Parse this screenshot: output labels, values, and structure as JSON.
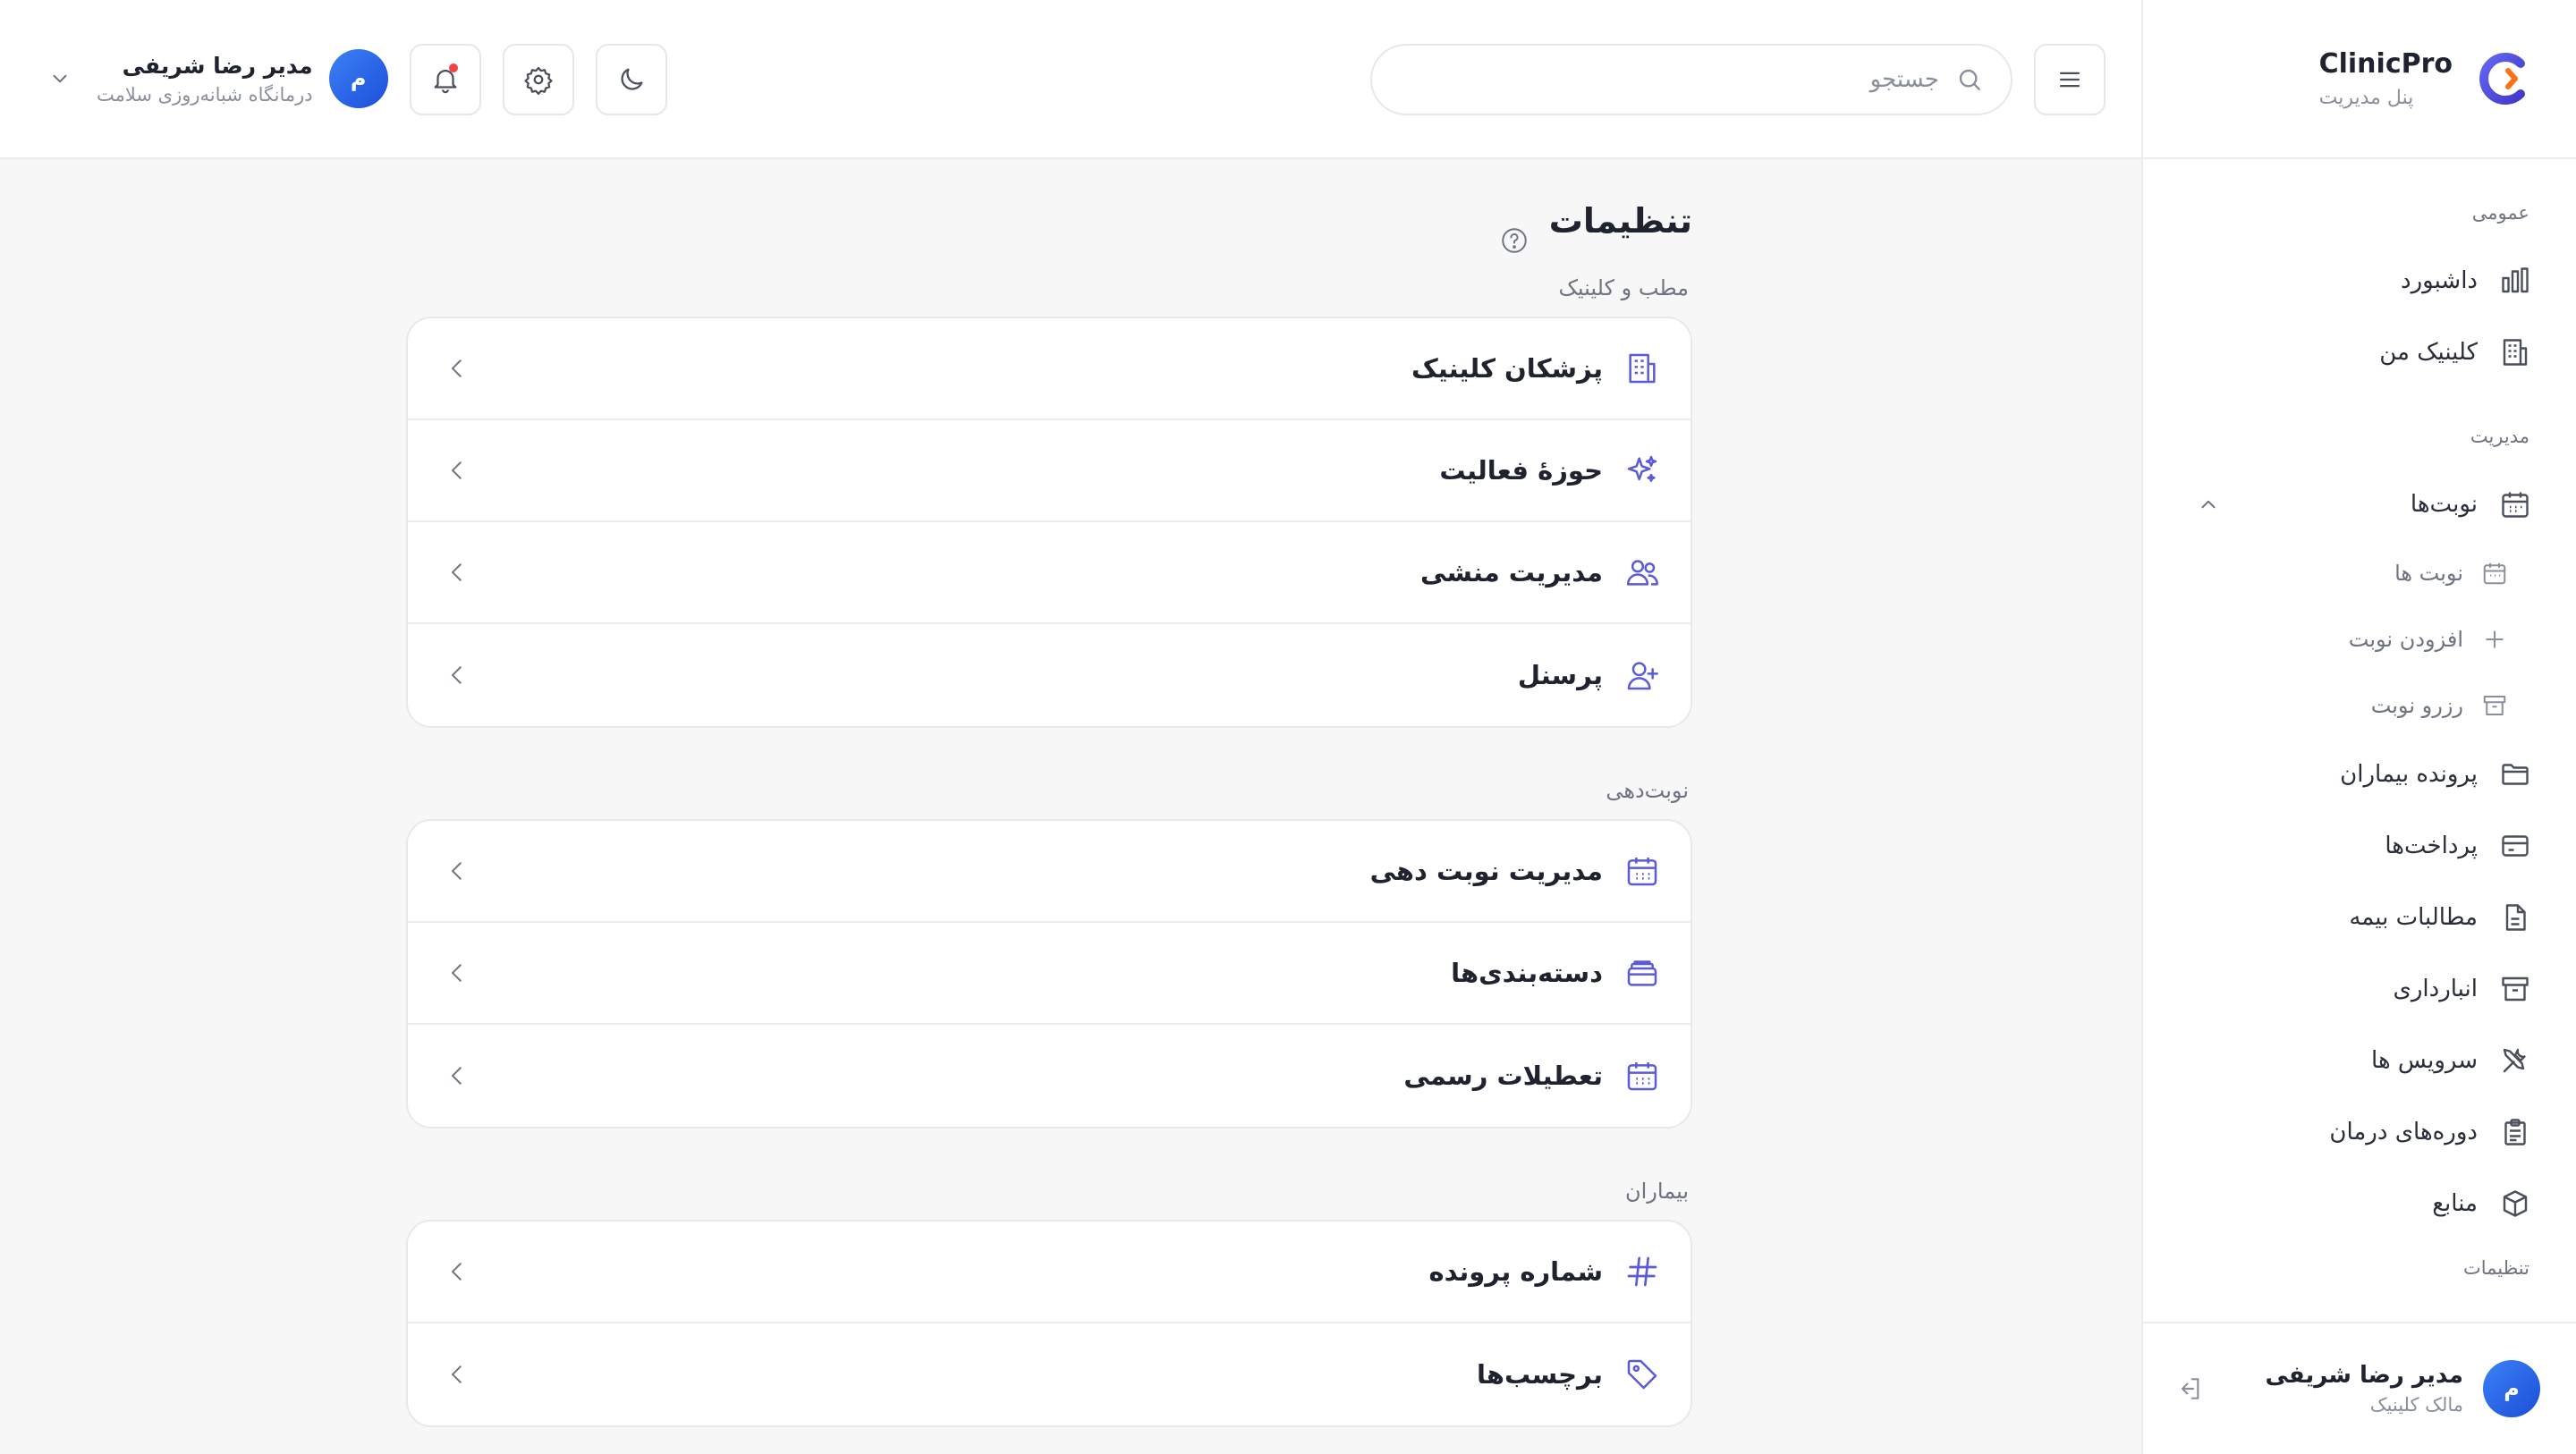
{
  "brand": {
    "name": "ClinicPro",
    "subtitle": "پنل مدیریت",
    "logo_color": "#4f46e5"
  },
  "sidebar": {
    "sections": {
      "general": "عمومی",
      "management": "مدیریت",
      "settings": "تنظیمات"
    },
    "items": [
      {
        "label": "داشبورد",
        "icon": "bar-chart-icon"
      },
      {
        "label": "کلینیک من",
        "icon": "building-icon"
      },
      {
        "label": "نوبت‌ها",
        "icon": "calendar-icon",
        "expanded": true
      },
      {
        "label": "پرونده بیماران",
        "icon": "folder-icon"
      },
      {
        "label": "پرداخت‌ها",
        "icon": "credit-card-icon"
      },
      {
        "label": "مطالبات بیمه",
        "icon": "file-icon"
      },
      {
        "label": "انبارداری",
        "icon": "archive-icon"
      },
      {
        "label": "سرویس ها",
        "icon": "tools-icon"
      },
      {
        "label": "دوره‌های درمان",
        "icon": "clipboard-icon"
      },
      {
        "label": "منابع",
        "icon": "box-icon"
      }
    ],
    "sub_items": [
      {
        "label": "نوبت ها",
        "icon": "calendar-icon"
      },
      {
        "label": "افزودن نوبت",
        "icon": "plus-icon"
      },
      {
        "label": "رزرو نوبت",
        "icon": "archive-icon"
      }
    ],
    "user": {
      "initial": "م",
      "name": "مدیر رضا شریفی",
      "role": "مالک کلینیک"
    }
  },
  "header": {
    "search_placeholder": "جستجو",
    "user": {
      "initial": "م",
      "name": "مدیر رضا شریفی",
      "clinic": "درمانگاه شبانه‌روزی سلامت"
    }
  },
  "page": {
    "title": "تنظیمات",
    "sections": [
      {
        "label": "مطب و کلینیک",
        "rows": [
          {
            "label": "پزشکان کلینیک",
            "icon": "building-icon"
          },
          {
            "label": "حوزهٔ فعالیت",
            "icon": "sparkles-icon"
          },
          {
            "label": "مدیریت منشی",
            "icon": "users-icon"
          },
          {
            "label": "پرسنل",
            "icon": "user-plus-icon"
          }
        ]
      },
      {
        "label": "نوبت‌دهی",
        "rows": [
          {
            "label": "مدیریت نوبت دهی",
            "icon": "calendar-icon"
          },
          {
            "label": "دسته‌بندی‌ها",
            "icon": "layers-icon"
          },
          {
            "label": "تعطیلات رسمی",
            "icon": "calendar-icon"
          }
        ]
      },
      {
        "label": "بیماران",
        "rows": [
          {
            "label": "شماره پرونده",
            "icon": "hash-icon"
          },
          {
            "label": "برچسب‌ها",
            "icon": "tag-icon"
          }
        ]
      }
    ]
  },
  "colors": {
    "accent": "#5b5bd6",
    "avatar": "#2563eb",
    "notification_dot": "#ef4444"
  }
}
